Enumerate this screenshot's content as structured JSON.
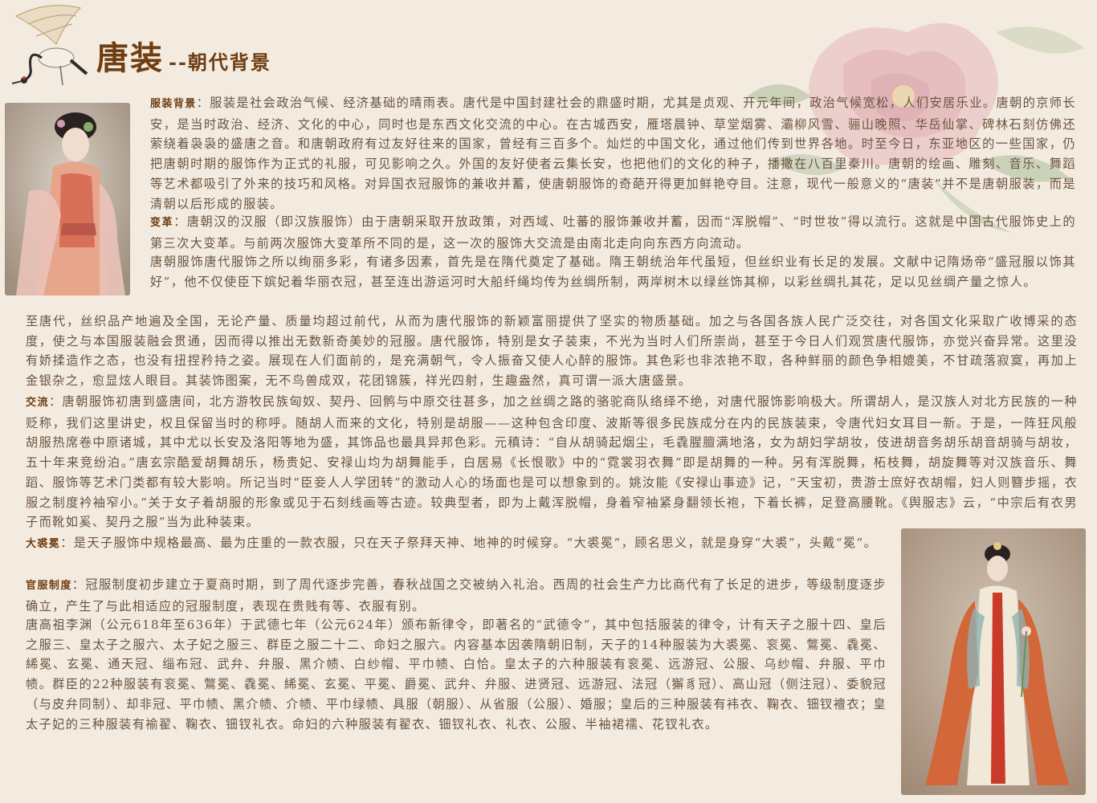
{
  "header": {
    "title_main": "唐装",
    "title_sub": "--朝代背景"
  },
  "images": {
    "crane": "crane-illustration",
    "peony": "peony-watermark",
    "photo_top": "woman-in-tang-dress-photo",
    "photo_bottom": "woman-in-tang-dress-full-photo"
  },
  "sections": {
    "background": {
      "label": "服装背景",
      "text": "：服装是社会政治气候、经济基础的晴雨表。唐代是中国封建社会的鼎盛时期，尤其是贞观、开元年间，政治气候宽松，人们安居乐业。唐朝的京师长安，是当时政治、经济、文化的中心，同时也是东西文化交流的中心。在古城西安，雁塔晨钟、草堂烟雾、灞柳风雪、骊山晚照、华岳仙掌、碑林石刻仿佛还萦绕着袅袅的盛唐之音。和唐朝政府有过友好往来的国家，曾经有三百多个。灿烂的中国文化，通过他们传到世界各地。时至今日，东亚地区的一些国家，仍把唐朝时期的服饰作为正式的礼服，可见影响之久。外国的友好使者云集长安，也把他们的文化的种子，播撒在八百里秦川。唐朝的绘画、雕刻、音乐、舞蹈等艺术都吸引了外来的技巧和风格。对异国衣冠服饰的兼收并蓄，使唐朝服饰的奇葩开得更加鲜艳夺目。注意，现代一般意义的“唐装”并不是唐朝服装，而是清朝以后形成的服装。"
    },
    "change": {
      "label": "变革",
      "text": "：唐朝汉的汉服（即汉族服饰）由于唐朝采取开放政策，对西域、吐蕃的服饰兼收并蓄，因而“浑脱帽”、“时世妆”得以流行。这就是中国古代服饰史上的第三次大变革。与前两次服饰大变革所不同的是，这一次的服饰大交流是由南北走向向东西方向流动。"
    },
    "reasons_1": "唐朝服饰唐代服饰之所以绚丽多彩，有诸多因素，首先是在隋代奠定了基础。隋王朝统治年代虽短，但丝织业有长足的发展。文献中记隋炀帝“盛冠服以饰其好”，他不仅使臣下嫔妃着华丽衣冠，甚至连出游运河时大船纤绳均传为丝绸所制，两岸树木以绿丝饰其柳，以彩丝绸扎其花，足以见丝绸产量之惊人。",
    "reasons_2": "至唐代，丝织品产地遍及全国，无论产量、质量均超过前代，从而为唐代服饰的新颖富丽提供了坚实的物质基础。加之与各国各族人民广泛交往，对各国文化采取广收博采的态度，使之与本国服装融会贯通，因而得以推出无数新奇美妙的冠服。唐代服饰，特别是女子装束，不光为当时人们所崇尚，甚至于今日人们观赏唐代服饰，亦觉兴奋异常。这里没有娇揉造作之态，也没有扭捏矜持之姿。展现在人们面前的，是充满朝气，令人振奋又使人心醉的服饰。其色彩也非浓艳不取，各种鲜丽的颜色争相媲美，不甘疏落寂寞，再加上金银杂之，愈显炫人眼目。其装饰图案，无不鸟兽成双，花团锦簇，祥光四射，生趣盎然，真可谓一派大唐盛景。",
    "exchange": {
      "label": "交流",
      "text": "：唐朝服饰初唐到盛唐间，北方游牧民族匈奴、契丹、回鹘与中原交往甚多，加之丝绸之路的骆驼商队络绎不绝，对唐代服饰影响极大。所谓胡人，是汉族人对北方民族的一种贬称，我们这里讲史，权且保留当时的称呼。随胡人而来的文化，特别是胡服——这种包含印度、波斯等很多民族成分在内的民族装束，令唐代妇女耳目一新。于是，一阵狂风般胡服热席卷中原诸城，其中尤以长安及洛阳等地为盛，其饰品也最具异邦色彩。元稹诗：“自从胡骑起烟尘，毛毳腥膻满地洛，女为胡妇学胡妆，伎进胡音务胡乐胡音胡骑与胡妆，五十年来竞纷泊。”唐玄宗酷爱胡舞胡乐，杨贵妃、安禄山均为胡舞能手，白居易《长恨歌》中的“霓裳羽衣舞”即是胡舞的一种。另有浑脱舞，柘枝舞，胡旋舞等对汉族音乐、舞蹈、服饰等艺术门类都有较大影响。所记当时“臣妾人人学团转”的激动人心的场面也是可以想象到的。姚汝能《安禄山事迹》记，“天宝初，贵游士庶好衣胡帽，妇人则簪步摇，衣服之制度衿袖窄小。”关于女子着胡服的形象或见于石刻线画等古迹。较典型者，即为上戴浑脱帽，身着窄袖紧身翻领长袍，下着长裤，足登高腰靴。《舆服志》云，“中宗后有衣男子而靴如奚、契丹之服”当为此种装束。"
    },
    "dachiumian": {
      "label": "大裘冕",
      "text": "：是天子服饰中规格最高、最为庄重的一款衣服，只在天子祭拜天神、地神的时候穿。“大裘冕”，顾名思义，就是身穿“大裘”，头戴“冕”。"
    },
    "official": {
      "label": "官服制度",
      "text": "：冠服制度初步建立于夏商时期，到了周代逐步完善，春秋战国之交被纳入礼治。西周的社会生产力比商代有了长足的进步，等级制度逐步确立，产生了与此相适应的冠服制度，表现在贵贱有等、衣服有别。"
    },
    "wude": "唐高祖李渊（公元618年至636年）于武德七年（公元624年）颁布新律令，即著名的“武德令”，其中包括服装的律令，计有天子之服十四、皇后之服三、皇太子之服六、太子妃之服三、群臣之服二十二、命妇之服六。内容基本因袭隋朝旧制，天子的14种服装为大裘冕、衮冕、鷩冕、毳冕、絺冕、玄冕、通天冠、缁布冠、武弁、弁服、黑介帻、白纱帽、平巾帻、白恰。皇太子的六种服装有衮冕、远游冠、公服、乌纱帽、弁服、平巾帻。群臣的22种服装有衮冕、鷩冕、毳冕、絺冕、玄冕、平冕、爵冕、武弁、弁服、进贤冠、远游冠、法冠（獬豸冠）、高山冠（侧注冠）、委貌冠（与皮弁同制）、却非冠、平巾帻、黑介帻、介帻、平巾绿帻、具服（朝服）、从省服（公服）、婚服；皇后的三种服装有袆衣、鞠衣、钿钗襢衣；皇太子妃的三种服装有褕翟、鞠衣、钿钗礼衣。命妇的六种服装有翟衣、钿钗礼衣、礼衣、公服、半袖裙襦、花钗礼衣。"
  }
}
